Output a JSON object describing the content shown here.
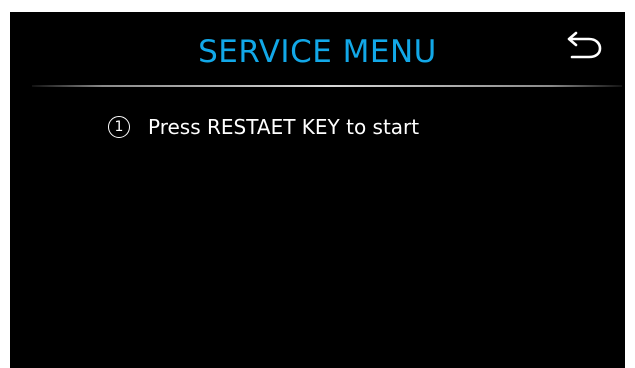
{
  "header": {
    "title": "SERVICE MENU",
    "back_icon": "back-arrow-icon"
  },
  "instructions": [
    {
      "number": "1",
      "text": "Press RESTAET KEY to start"
    }
  ],
  "colors": {
    "background": "#000000",
    "title": "#12a8e8",
    "text": "#ffffff"
  }
}
